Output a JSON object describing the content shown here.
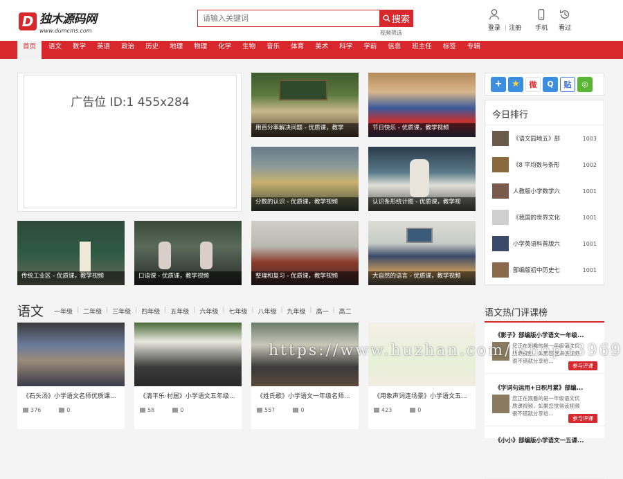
{
  "logo": {
    "mark": "D",
    "title": "独木源码网",
    "subtitle": "www.dumcms.com"
  },
  "search": {
    "placeholder": "请输入关键词",
    "button": "搜索",
    "sub_link": "视频筛选"
  },
  "header_icons": [
    {
      "label": "登录",
      "icon": "user-icon"
    },
    {
      "label": "注册",
      "icon": ""
    },
    {
      "label": "手机",
      "icon": "phone-icon"
    },
    {
      "label": "看过",
      "icon": "history-icon"
    }
  ],
  "nav": [
    "首页",
    "语文",
    "数学",
    "英语",
    "政治",
    "历史",
    "地理",
    "物理",
    "化学",
    "生物",
    "音乐",
    "体育",
    "美术",
    "科学",
    "学前",
    "信息",
    "班主任",
    "标签",
    "专辑"
  ],
  "ad": {
    "text": "广告位 ID:1 455x284"
  },
  "featured": [
    {
      "caption": "用百分率解决问题 - 优质课，教学"
    },
    {
      "caption": "节日快乐 - 优质课，教学视频"
    },
    {
      "caption": "分数的认识 - 优质课，教学视频"
    },
    {
      "caption": "认识条形统计图 - 优质课，教学视"
    },
    {
      "caption": "传统工业区 - 优质课，教学视频"
    },
    {
      "caption": "口语课 - 优质课，教学视频"
    },
    {
      "caption": "整理和复习 - 优质课，教学视频"
    },
    {
      "caption": "大自然的语言 - 优质课，教学视频"
    }
  ],
  "share": {
    "icons": [
      "plus-share-icon",
      "star-share-icon",
      "weibo-icon",
      "tencent-icon",
      "tieba-icon",
      "wechat-icon"
    ],
    "tieba_label": "贴"
  },
  "ranking": {
    "title": "今日排行",
    "items": [
      {
        "name": "《语文园地五》部",
        "count": "1003"
      },
      {
        "name": "《8 平均数与条形",
        "count": "1002"
      },
      {
        "name": "人教版小学数学六",
        "count": "1001"
      },
      {
        "name": "《我国的世界文化",
        "count": "1001"
      },
      {
        "name": "小学英语科普版六",
        "count": "1001"
      },
      {
        "name": "部编版初中历史七",
        "count": "1001"
      }
    ]
  },
  "section": {
    "title": "语文",
    "grades": [
      "一年级",
      "二年级",
      "三年级",
      "四年级",
      "五年级",
      "六年级",
      "七年级",
      "八年级",
      "九年级",
      "高一",
      "高二"
    ]
  },
  "cards": [
    {
      "title": "《石头汤》小学语文名师优质课...",
      "views": "376",
      "comments": "0"
    },
    {
      "title": "《清平乐·村居》小学语文五年级...",
      "views": "58",
      "comments": "0"
    },
    {
      "title": "《姓氏歌》小学语文一年级名师...",
      "views": "557",
      "comments": "0"
    },
    {
      "title": "《用象声词连场景》小学语文五...",
      "views": "423",
      "comments": "0"
    }
  ],
  "hot": {
    "title": "语文热门评课榜",
    "items": [
      {
        "title": "《影子》部编版小学语文一年级...",
        "desc": "您正在观看的是一年级语文优质课视频，如果您觉得该视频很不错就分享给...",
        "button": "参与评课"
      },
      {
        "title": "《字词句运用+日积月累》部编...",
        "desc": "您正在观看的是一年级语文优质课视频，如果您觉得该视频很不错就分享给...",
        "button": "参与评课"
      },
      {
        "title": "《小小》部编版小学语文一五课...",
        "desc": "",
        "button": ""
      }
    ]
  },
  "watermark": "https://www.huzhan.com/ishop33969",
  "colors": {
    "brand_red": "#d8272d"
  }
}
